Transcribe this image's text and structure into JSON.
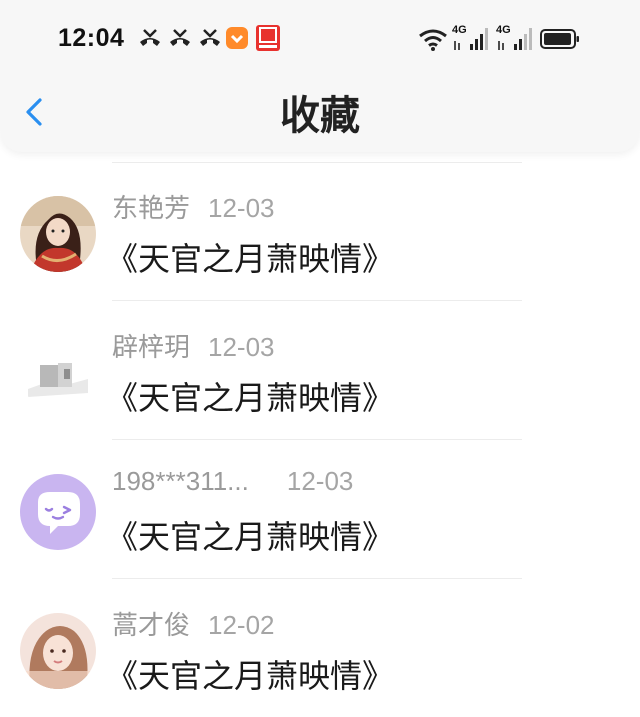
{
  "status_bar": {
    "time": "12:04",
    "network_1": "4G",
    "network_2": "4G"
  },
  "header": {
    "title": "收藏",
    "back_icon": "chevron-left-icon",
    "accent_color": "#2a8ff0"
  },
  "items": [
    {
      "name": "东艳芳",
      "date": "12-03",
      "content": "《天官之月萧映情》",
      "avatar": "anime-girl-avatar"
    },
    {
      "name": "辟梓玥",
      "date": "12-03",
      "content": "《天官之月萧映情》",
      "avatar": "photo-avatar"
    },
    {
      "name": "198***311...",
      "date": "12-03",
      "content": "《天官之月萧映情》",
      "avatar": "default-chat-avatar"
    },
    {
      "name": "蒿才俊",
      "date": "12-02",
      "content": "《天官之月萧映情》",
      "avatar": "girl-photo-avatar"
    }
  ]
}
